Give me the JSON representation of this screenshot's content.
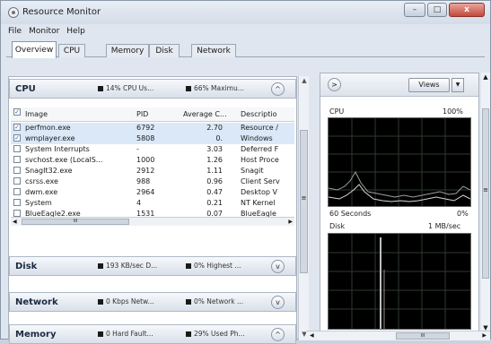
{
  "window": {
    "title": "Resource Monitor",
    "min": "–",
    "max": "□",
    "close": "x"
  },
  "menu": [
    "File",
    "Monitor",
    "Help"
  ],
  "tabs": [
    "Overview",
    "CPU",
    "Memory",
    "Disk",
    "Network"
  ],
  "active_tab": "Overview",
  "cpu_section": {
    "title": "CPU",
    "metric1": "14% CPU Us...",
    "metric2": "66% Maximu...",
    "metric1_color": "#1a1a1a",
    "metric2_color": "#1a1a1a",
    "toggle": "^",
    "columns": [
      "Image",
      "PID",
      "Average C...",
      "Descriptio"
    ],
    "rows": [
      {
        "checked": true,
        "image": "perfmon.exe",
        "pid": "6792",
        "avg": "2.70",
        "desc": "Resource /"
      },
      {
        "checked": true,
        "image": "wmplayer.exe",
        "pid": "5808",
        "avg": "0.",
        "desc": "Windows"
      },
      {
        "checked": false,
        "image": "System Interrupts",
        "pid": "-",
        "avg": "3.03",
        "desc": "Deferred F"
      },
      {
        "checked": false,
        "image": "svchost.exe (LocalS...",
        "pid": "1000",
        "avg": "1.26",
        "desc": "Host Proce"
      },
      {
        "checked": false,
        "image": "SnagIt32.exe",
        "pid": "2912",
        "avg": "1.11",
        "desc": "Snagit"
      },
      {
        "checked": false,
        "image": "csrss.exe",
        "pid": "988",
        "avg": "0.96",
        "desc": "Client Serv"
      },
      {
        "checked": false,
        "image": "dwm.exe",
        "pid": "2964",
        "avg": "0.47",
        "desc": "Desktop V"
      },
      {
        "checked": false,
        "image": "System",
        "pid": "4",
        "avg": "0.21",
        "desc": "NT Kernel"
      },
      {
        "checked": false,
        "image": "BlueEagle2.exe",
        "pid": "1531",
        "avg": "0.07",
        "desc": "BlueEagle"
      }
    ],
    "hscroll_left": "◀",
    "hscroll_right": "▶",
    "hscroll_grip": "III"
  },
  "disk_section": {
    "title": "Disk",
    "metric1": "193 KB/sec D...",
    "metric2": "0% Highest ...",
    "metric1_color": "#1a1a1a",
    "metric2_color": "#1a1a1a",
    "toggle": "v"
  },
  "network_section": {
    "title": "Network",
    "metric1": "0 Kbps Netw...",
    "metric2": "0% Network ...",
    "metric1_color": "#1a1a1a",
    "metric2_color": "#1a1a1a",
    "toggle": "v"
  },
  "memory_section": {
    "title": "Memory",
    "metric1": "0 Hard Fault...",
    "metric2": "29% Used Ph...",
    "metric1_color": "#1a1a1a",
    "metric2_color": "#1a1a1a",
    "toggle": "^"
  },
  "right_pane": {
    "expand_btn": ">",
    "views_label": "Views",
    "views_arrow": "▼",
    "cpu_graph": {
      "title": "CPU",
      "max": "100%",
      "footer_left": "60 Seconds",
      "footer_right": "0%"
    },
    "disk_graph": {
      "title": "Disk",
      "max": "1 MB/sec"
    },
    "hscroll_left": "◀",
    "hscroll_right": "▶",
    "hscroll_grip": "III"
  },
  "scroll": {
    "up": "▲",
    "down": "▼",
    "grip": "≡"
  }
}
